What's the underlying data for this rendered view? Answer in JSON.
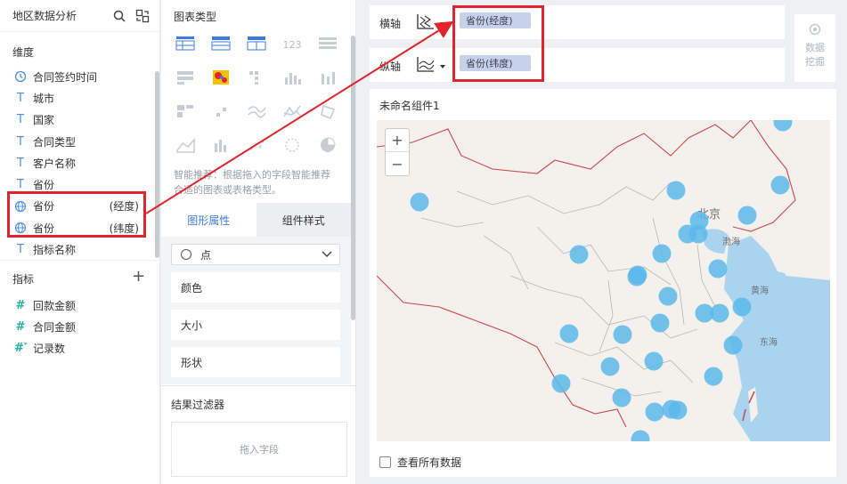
{
  "left_panel": {
    "title": "地区数据分析",
    "dimension_title": "维度",
    "dimensions": [
      {
        "label": "合同签约时间",
        "icon": "clock-icon",
        "suffix": ""
      },
      {
        "label": "城市",
        "icon": "text-type-icon",
        "suffix": ""
      },
      {
        "label": "国家",
        "icon": "text-type-icon",
        "suffix": ""
      },
      {
        "label": "合同类型",
        "icon": "text-type-icon",
        "suffix": ""
      },
      {
        "label": "客户名称",
        "icon": "text-type-icon",
        "suffix": ""
      },
      {
        "label": "省份",
        "icon": "text-type-icon",
        "suffix": ""
      },
      {
        "label": "省份",
        "icon": "globe-icon",
        "suffix": "(经度)"
      },
      {
        "label": "省份",
        "icon": "globe-icon",
        "suffix": "(纬度)"
      },
      {
        "label": "指标名称",
        "icon": "text-type-icon",
        "suffix": ""
      }
    ],
    "metric_title": "指标",
    "metrics": [
      {
        "label": "回款金额",
        "icon": "hash-icon"
      },
      {
        "label": "合同金额",
        "icon": "hash-icon"
      },
      {
        "label": "记录数",
        "icon": "hash-star-icon"
      }
    ]
  },
  "middle_panel": {
    "chart_type_title": "图表类型",
    "hint": "智能推荐：根据拖入的字段智能推荐合适的图表或表格类型。",
    "tabs": [
      {
        "label": "图形属性"
      },
      {
        "label": "组件样式"
      }
    ],
    "mark_type": "点",
    "props": [
      "颜色",
      "大小",
      "形状"
    ],
    "filter_title": "结果过滤器",
    "filter_placeholder": "拖入字段",
    "chart_icons": [
      "table-icon",
      "cross-table-icon",
      "detail-table-icon",
      "kpi-number-icon",
      "list-icon",
      "grouped-table-icon",
      "heatmap-icon",
      "scatter-grid-icon",
      "bar-icon",
      "column-icon",
      "treemap-icon",
      "dot-icon",
      "line-icon",
      "radar-icon",
      "funnel-icon",
      "area-icon",
      "histogram-icon",
      "scatter-icon",
      "bubble-icon",
      "pie-icon"
    ]
  },
  "axes": {
    "x_label": "横轴",
    "x_value": "省份(经度)",
    "y_label": "纵轴",
    "y_value": "省份(纬度)"
  },
  "data_mining": {
    "line1": "数据",
    "line2": "挖掘"
  },
  "widget": {
    "title": "未命名组件1",
    "show_all": "查看所有数据",
    "zoom_in": "+",
    "zoom_out": "−",
    "map_labels": [
      "北京",
      "渤海",
      "黄海",
      "东海"
    ],
    "point_color": "#5ab9ea"
  }
}
